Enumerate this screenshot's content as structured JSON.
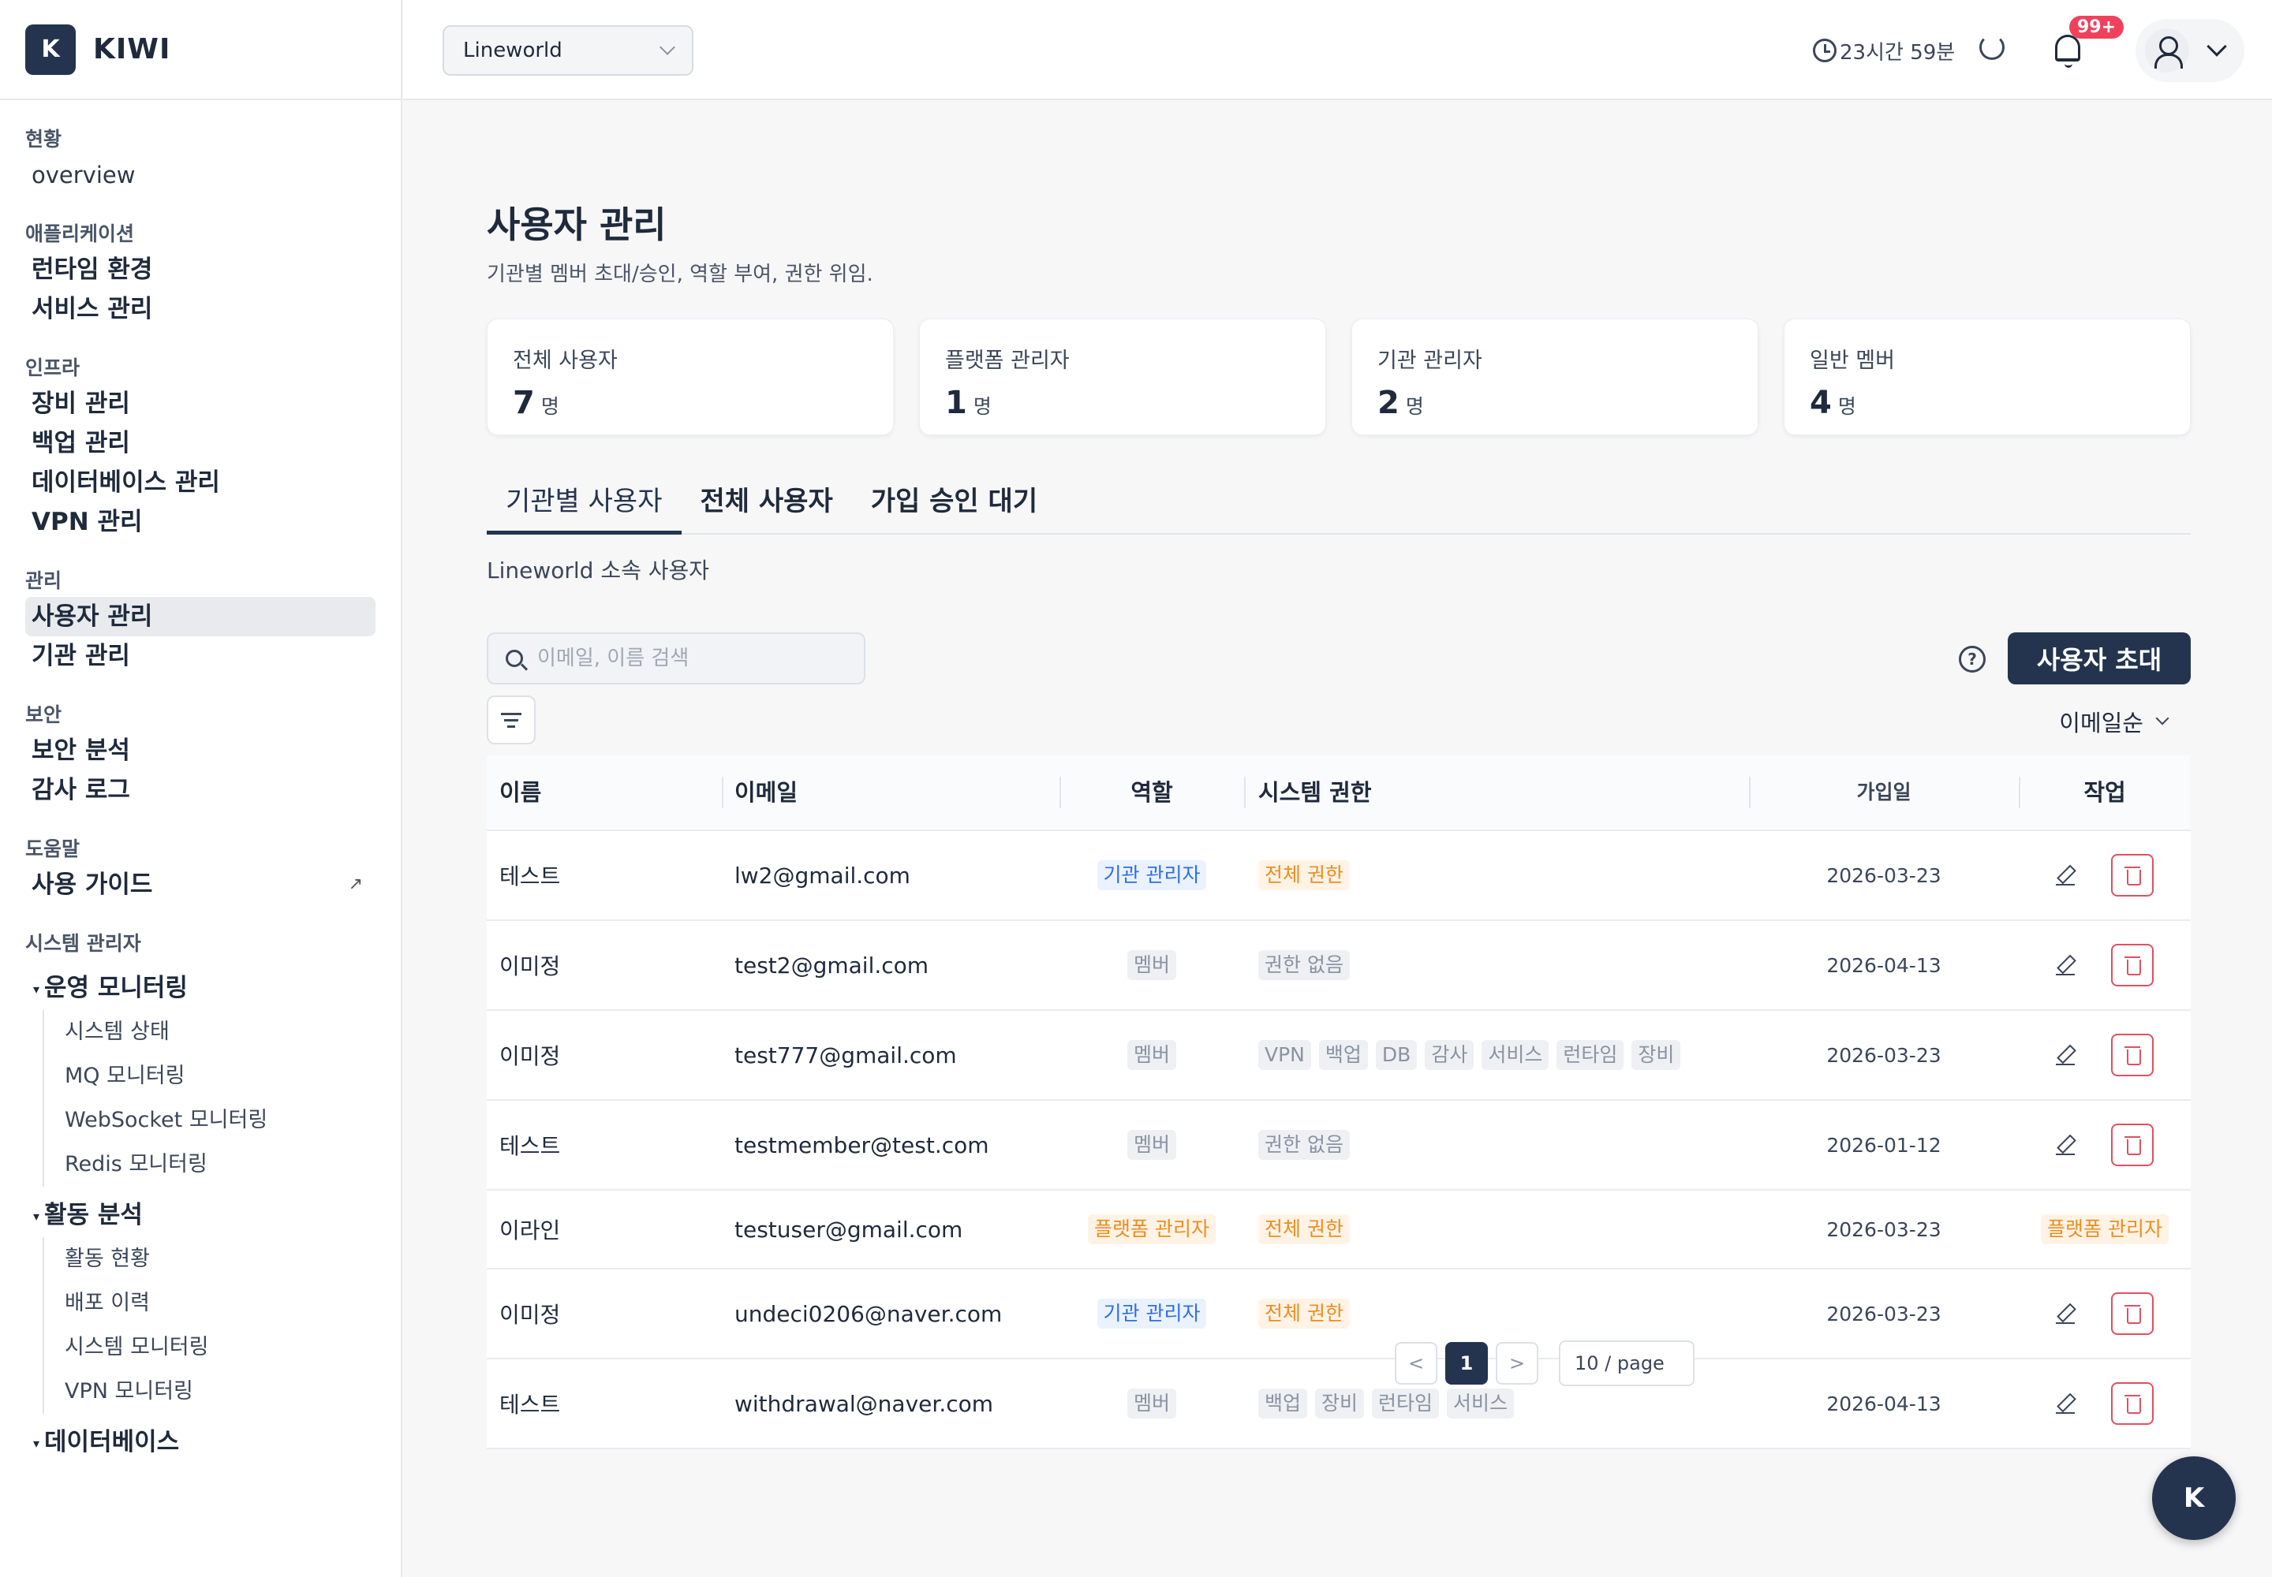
{
  "brand": {
    "logo_letter": "K",
    "name": "KIWI"
  },
  "sidebar": {
    "groups": [
      {
        "title": "현황",
        "items": [
          "overview"
        ]
      },
      {
        "title": "애플리케이션",
        "items": [
          "런타임 환경",
          "서비스 관리"
        ]
      },
      {
        "title": "인프라",
        "items": [
          "장비 관리",
          "백업 관리",
          "데이터베이스 관리",
          "VPN 관리"
        ]
      },
      {
        "title": "관리",
        "items": [
          "사용자 관리",
          "기관 관리"
        ]
      },
      {
        "title": "보안",
        "items": [
          "보안 분석",
          "감사 로그"
        ]
      },
      {
        "title": "도움말",
        "items": [
          "사용 가이드"
        ]
      }
    ],
    "admin_title": "시스템 관리자",
    "sub_groups": [
      {
        "title": "운영 모니터링",
        "items": [
          "시스템 상태",
          "MQ 모니터링",
          "WebSocket 모니터링",
          "Redis 모니터링"
        ]
      },
      {
        "title": "활동 분석",
        "items": [
          "활동 현황",
          "배포 이력",
          "시스템 모니터링",
          "VPN 모니터링"
        ]
      },
      {
        "title": "데이터베이스",
        "items": []
      }
    ],
    "active_item": "사용자 관리"
  },
  "header": {
    "org_select": "Lineworld",
    "session_time": "23시간 59분",
    "notification_badge": "99+"
  },
  "page": {
    "title": "사용자 관리",
    "subtitle": "기관별 멤버 초대/승인, 역할 부여, 권한 위임."
  },
  "stats": [
    {
      "label": "전체 사용자",
      "value": "7",
      "unit": "명"
    },
    {
      "label": "플랫폼 관리자",
      "value": "1",
      "unit": "명"
    },
    {
      "label": "기관 관리자",
      "value": "2",
      "unit": "명"
    },
    {
      "label": "일반 멤버",
      "value": "4",
      "unit": "명"
    }
  ],
  "tabs": [
    {
      "label": "기관별 사용자",
      "active": true
    },
    {
      "label": "전체 사용자",
      "active": false
    },
    {
      "label": "가입 승인 대기",
      "active": false
    }
  ],
  "section_label": "Lineworld 소속 사용자",
  "search": {
    "placeholder": "이메일, 이름 검색"
  },
  "help_label": "?",
  "invite_button": "사용자 초대",
  "sort_label": "이메일순",
  "table": {
    "headers": {
      "name": "이름",
      "email": "이메일",
      "role": "역할",
      "perm": "시스템 권한",
      "date": "가입일",
      "action": "작업"
    },
    "rows": [
      {
        "name": "테스트",
        "email": "lw2@gmail.com",
        "role": "기관 관리자",
        "role_color": "blue",
        "perms": [
          "전체 권한"
        ],
        "perm_color": "orange",
        "date": "2026-03-23",
        "action": "edit-delete"
      },
      {
        "name": "이미정",
        "email": "test2@gmail.com",
        "role": "멤버",
        "role_color": "gray",
        "perms": [
          "권한 없음"
        ],
        "perm_color": "gray",
        "date": "2026-04-13",
        "action": "edit-delete"
      },
      {
        "name": "이미정",
        "email": "test777@gmail.com",
        "role": "멤버",
        "role_color": "gray",
        "perms": [
          "VPN",
          "백업",
          "DB",
          "감사",
          "서비스",
          "런타임",
          "장비"
        ],
        "perm_color": "gray",
        "date": "2026-03-23",
        "action": "edit-delete"
      },
      {
        "name": "테스트",
        "email": "testmember@test.com",
        "role": "멤버",
        "role_color": "gray",
        "perms": [
          "권한 없음"
        ],
        "perm_color": "gray",
        "date": "2026-01-12",
        "action": "edit-delete"
      },
      {
        "name": "이라인",
        "email": "testuser@gmail.com",
        "role": "플랫폼 관리자",
        "role_color": "orange",
        "perms": [
          "전체 권한"
        ],
        "perm_color": "orange",
        "date": "2026-03-23",
        "action": "플랫폼 관리자"
      },
      {
        "name": "이미정",
        "email": "undeci0206@naver.com",
        "role": "기관 관리자",
        "role_color": "blue",
        "perms": [
          "전체 권한"
        ],
        "perm_color": "orange",
        "date": "2026-03-23",
        "action": "edit-delete"
      },
      {
        "name": "테스트",
        "email": "withdrawal@naver.com",
        "role": "멤버",
        "role_color": "gray",
        "perms": [
          "백업",
          "장비",
          "런타임",
          "서비스"
        ],
        "perm_color": "gray",
        "date": "2026-04-13",
        "action": "edit-delete"
      }
    ]
  },
  "pagination": {
    "prev": "<",
    "current": "1",
    "next": ">",
    "page_size": "10 / page"
  },
  "fab_label": "K",
  "colors": {
    "primary": "#24344f",
    "blue_tag": "#2f6fe0",
    "orange_tag": "#f08c1e",
    "danger": "#e15061",
    "badge": "#f0415c"
  }
}
